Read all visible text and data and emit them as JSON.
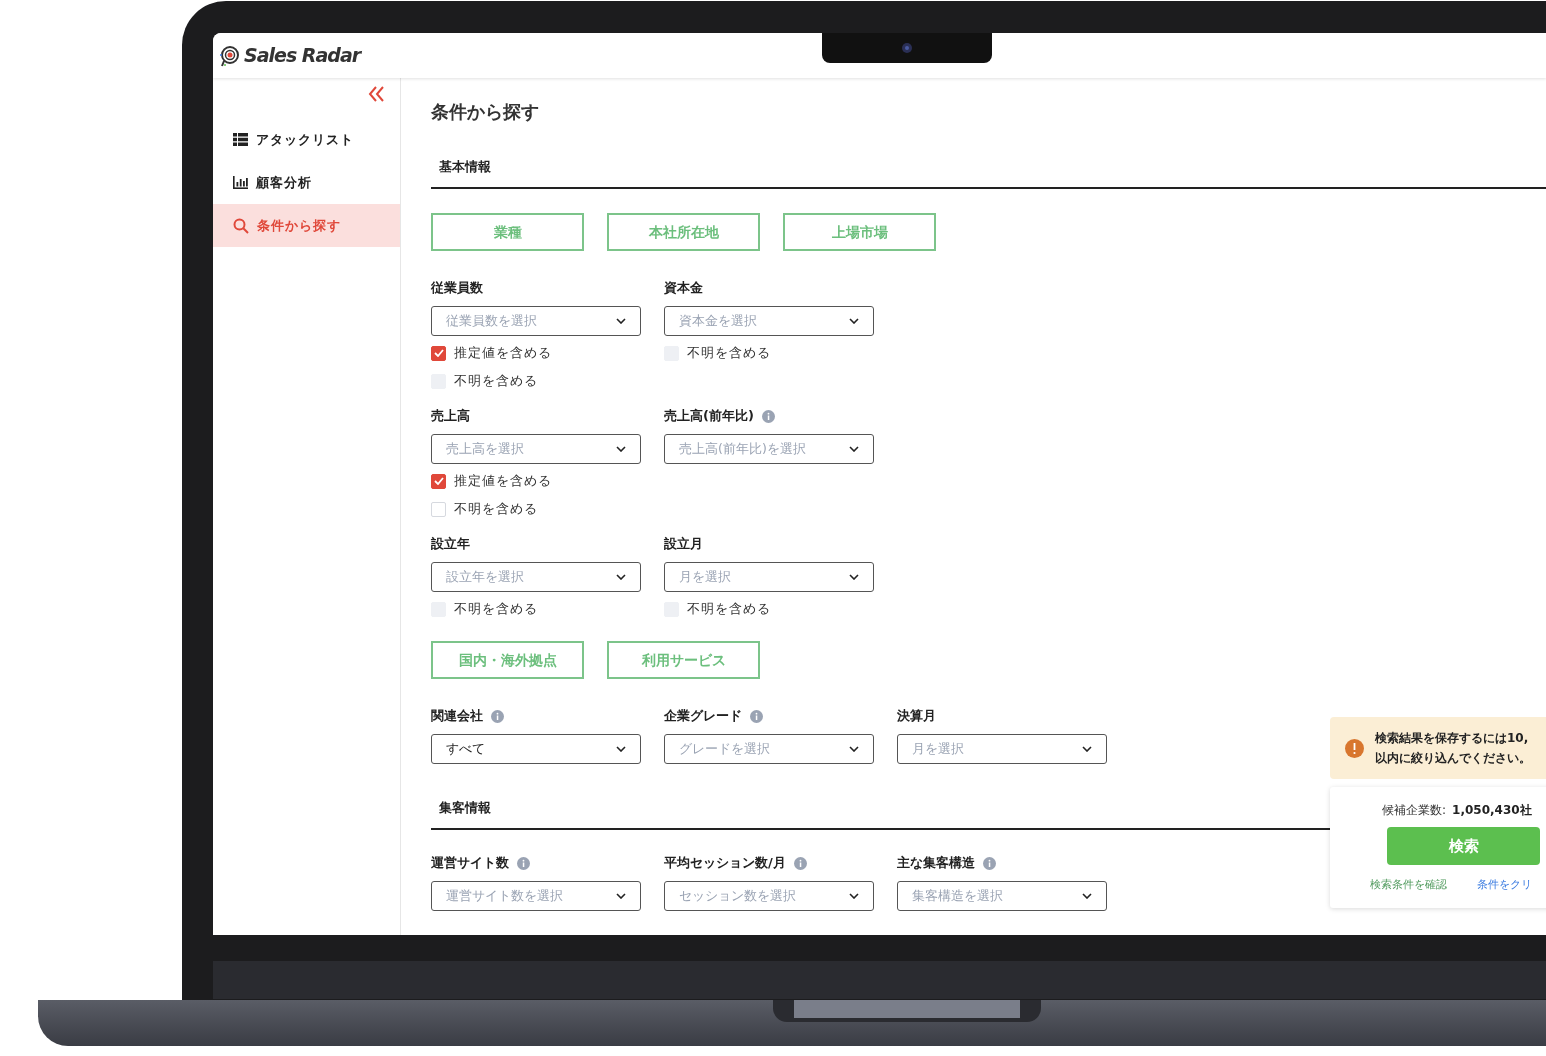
{
  "header": {
    "logo": "Sales Radar"
  },
  "sidebar": {
    "items": [
      {
        "label": "アタックリスト",
        "selected": false
      },
      {
        "label": "顧客分析",
        "selected": false
      },
      {
        "label": "条件から探す",
        "selected": true
      }
    ]
  },
  "page": {
    "title": "条件から探す"
  },
  "blocks": [
    {
      "kind": "heading",
      "text": "基本情報"
    },
    {
      "kind": "buttons",
      "items": [
        "業種",
        "本社所在地",
        "上場市場"
      ]
    },
    {
      "kind": "fields",
      "fields": [
        {
          "label": "従業員数",
          "info": false,
          "placeholder": "従業員数を選択",
          "checkboxes": [
            {
              "label": "推定値を含める",
              "checked": true,
              "disabled": false
            },
            {
              "label": "不明を含める",
              "checked": false,
              "disabled": true
            }
          ]
        },
        {
          "label": "資本金",
          "info": false,
          "placeholder": "資本金を選択",
          "checkboxes": [
            {
              "label": "不明を含める",
              "checked": false,
              "disabled": true
            }
          ]
        }
      ]
    },
    {
      "kind": "fields",
      "fields": [
        {
          "label": "売上高",
          "info": false,
          "placeholder": "売上高を選択",
          "checkboxes": [
            {
              "label": "推定値を含める",
              "checked": true,
              "disabled": false
            },
            {
              "label": "不明を含める",
              "checked": false,
              "disabled": false
            }
          ]
        },
        {
          "label": "売上高(前年比)",
          "info": true,
          "placeholder": "売上高(前年比)を選択"
        }
      ]
    },
    {
      "kind": "fields",
      "fields": [
        {
          "label": "設立年",
          "info": false,
          "placeholder": "設立年を選択",
          "checkboxes": [
            {
              "label": "不明を含める",
              "checked": false,
              "disabled": true
            }
          ]
        },
        {
          "label": "設立月",
          "info": false,
          "placeholder": "月を選択",
          "checkboxes": [
            {
              "label": "不明を含める",
              "checked": false,
              "disabled": true
            }
          ]
        }
      ]
    },
    {
      "kind": "buttons",
      "items": [
        "国内・海外拠点",
        "利用サービス"
      ]
    },
    {
      "kind": "fields",
      "fields": [
        {
          "label": "関連会社",
          "info": true,
          "value": "すべて"
        },
        {
          "label": "企業グレード",
          "info": true,
          "placeholder": "グレードを選択"
        },
        {
          "label": "決算月",
          "info": false,
          "placeholder": "月を選択"
        }
      ]
    },
    {
      "kind": "heading",
      "text": "集客情報"
    },
    {
      "kind": "fields",
      "fields": [
        {
          "label": "運営サイト数",
          "info": true,
          "placeholder": "運営サイト数を選択"
        },
        {
          "label": "平均セッション数/月",
          "info": true,
          "placeholder": "セッション数を選択"
        },
        {
          "label": "主な集客構造",
          "info": true,
          "placeholder": "集客構造を選択"
        }
      ]
    }
  ],
  "notice": {
    "lines": [
      "検索結果を保存するには10,",
      "以内に絞り込んでください。"
    ]
  },
  "summary": {
    "label": "候補企業数:",
    "count": "1,050,430社",
    "search_button": "検索",
    "confirm_link": "検索条件を確認",
    "clear_link": "条件をクリ"
  }
}
